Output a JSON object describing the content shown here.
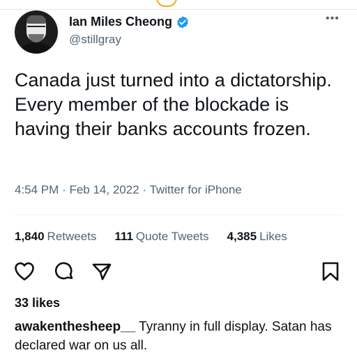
{
  "tweet": {
    "author_name": "Ian Miles Cheong",
    "author_handle": "@stillgray",
    "verified": true,
    "text": "Canada just turned into a dictatorship. Every member of the blockade is having their banks accounts frozen.",
    "time": "4:54 PM",
    "date": "Feb 14, 2022",
    "client": "Twitter for iPhone",
    "separator": "·",
    "stats": [
      {
        "count": "1,840",
        "label": "Retweets"
      },
      {
        "count": "111",
        "label": "Quote Tweets"
      },
      {
        "count": "4,385",
        "label": "Likes"
      }
    ]
  },
  "post": {
    "likes_text": "33 likes",
    "comment": {
      "user": "awakenthesheep__",
      "text": "Tyranny in full display. Satan has declared war on us all."
    }
  },
  "icons": {
    "verified": "verified-badge-icon",
    "more": "more-options-icon",
    "like": "heart-icon",
    "comment": "comment-bubble-icon",
    "share": "send-arrow-icon",
    "save": "bookmark-icon"
  },
  "colors": {
    "verified": "#1d9bf0",
    "secondary_text": "#536471",
    "primary_text": "#0f1419"
  }
}
